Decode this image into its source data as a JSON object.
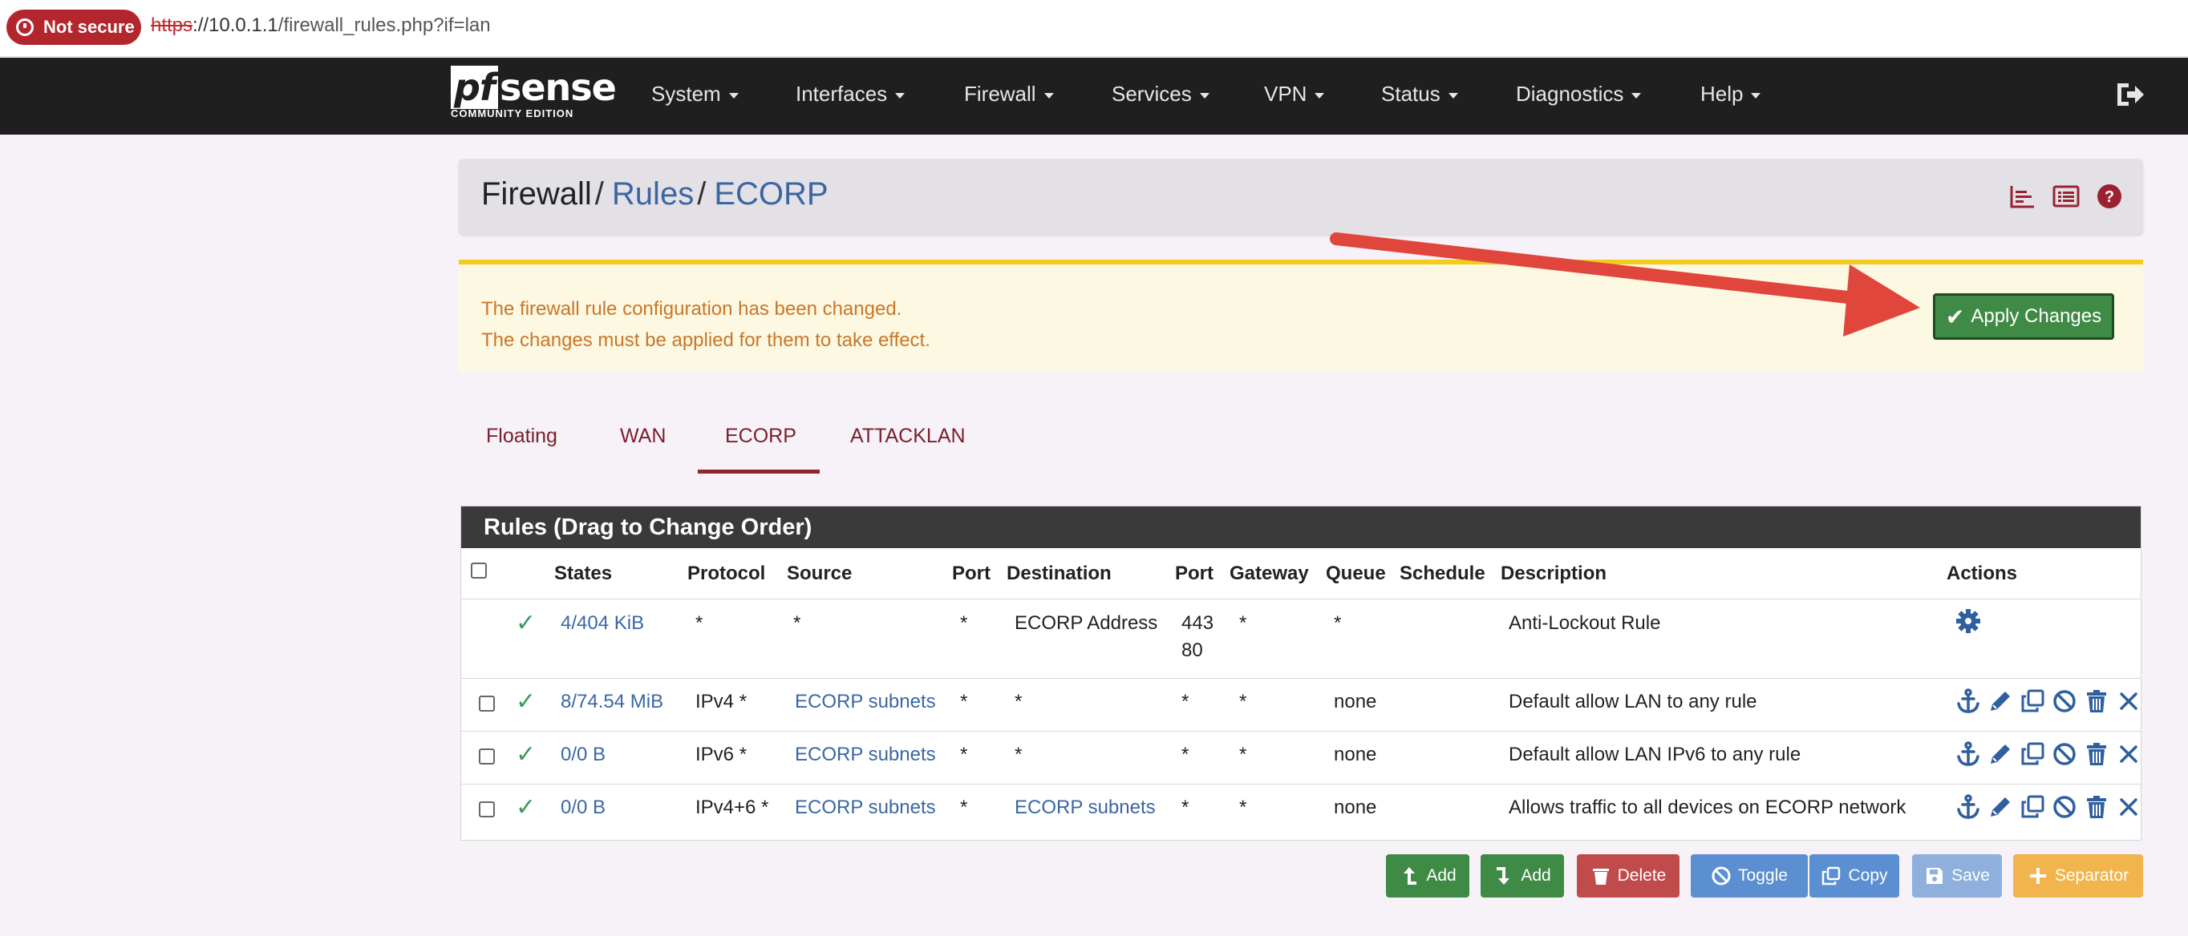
{
  "browser": {
    "security_label": "Not secure",
    "url_protocol": "https",
    "url_rest": "://10.0.1.1",
    "url_path": "/firewall_rules.php?if=lan"
  },
  "nav": {
    "logo_main": "sense",
    "logo_pf": "pf",
    "logo_sub": "COMMUNITY EDITION",
    "items": [
      "System",
      "Interfaces",
      "Firewall",
      "Services",
      "VPN",
      "Status",
      "Diagnostics",
      "Help"
    ]
  },
  "breadcrumb": {
    "part1": "Firewall",
    "sep1": "/",
    "part2": "Rules",
    "sep2": "/",
    "part3": "ECORP"
  },
  "alert": {
    "line1": "The firewall rule configuration has been changed.",
    "line2": "The changes must be applied for them to take effect.",
    "apply_label": "Apply Changes"
  },
  "tabs": [
    "Floating",
    "WAN",
    "ECORP",
    "ATTACKLAN"
  ],
  "active_tab": "ECORP",
  "rules": {
    "title": "Rules (Drag to Change Order)",
    "headers": {
      "states": "States",
      "protocol": "Protocol",
      "source": "Source",
      "port": "Port",
      "destination": "Destination",
      "port2": "Port",
      "gateway": "Gateway",
      "queue": "Queue",
      "schedule": "Schedule",
      "description": "Description",
      "actions": "Actions"
    },
    "rows": [
      {
        "states": "4/404 KiB",
        "protocol": "*",
        "source": "*",
        "port": "*",
        "destination": "ECORP Address",
        "port2a": "443",
        "port2b": "80",
        "gateway": "*",
        "queue": "*",
        "schedule": "",
        "description": "Anti-Lockout Rule"
      },
      {
        "states": "8/74.54 MiB",
        "protocol": "IPv4 *",
        "source": "ECORP subnets",
        "port": "*",
        "destination": "*",
        "port2": "*",
        "gateway": "*",
        "queue": "none",
        "schedule": "",
        "description": "Default allow LAN to any rule"
      },
      {
        "states": "0/0 B",
        "protocol": "IPv6 *",
        "source": "ECORP subnets",
        "port": "*",
        "destination": "*",
        "port2": "*",
        "gateway": "*",
        "queue": "none",
        "schedule": "",
        "description": "Default allow LAN IPv6 to any rule"
      },
      {
        "states": "0/0 B",
        "protocol": "IPv4+6 *",
        "source": "ECORP subnets",
        "port": "*",
        "destination": "ECORP subnets",
        "port2": "*",
        "gateway": "*",
        "queue": "none",
        "schedule": "",
        "description": "Allows traffic to all devices on ECORP network"
      }
    ]
  },
  "buttons": {
    "add_top": "Add",
    "add_bottom": "Add",
    "delete": "Delete",
    "toggle": "Toggle",
    "copy": "Copy",
    "save": "Save",
    "separator": "Separator"
  },
  "colors": {
    "navbar": "#1f1f1f",
    "link": "#3a67a3",
    "apply_green": "#3f8a44",
    "alert_text": "#c8772a",
    "tab_red": "#8e2630",
    "annotation_arrow": "#e0463c"
  }
}
